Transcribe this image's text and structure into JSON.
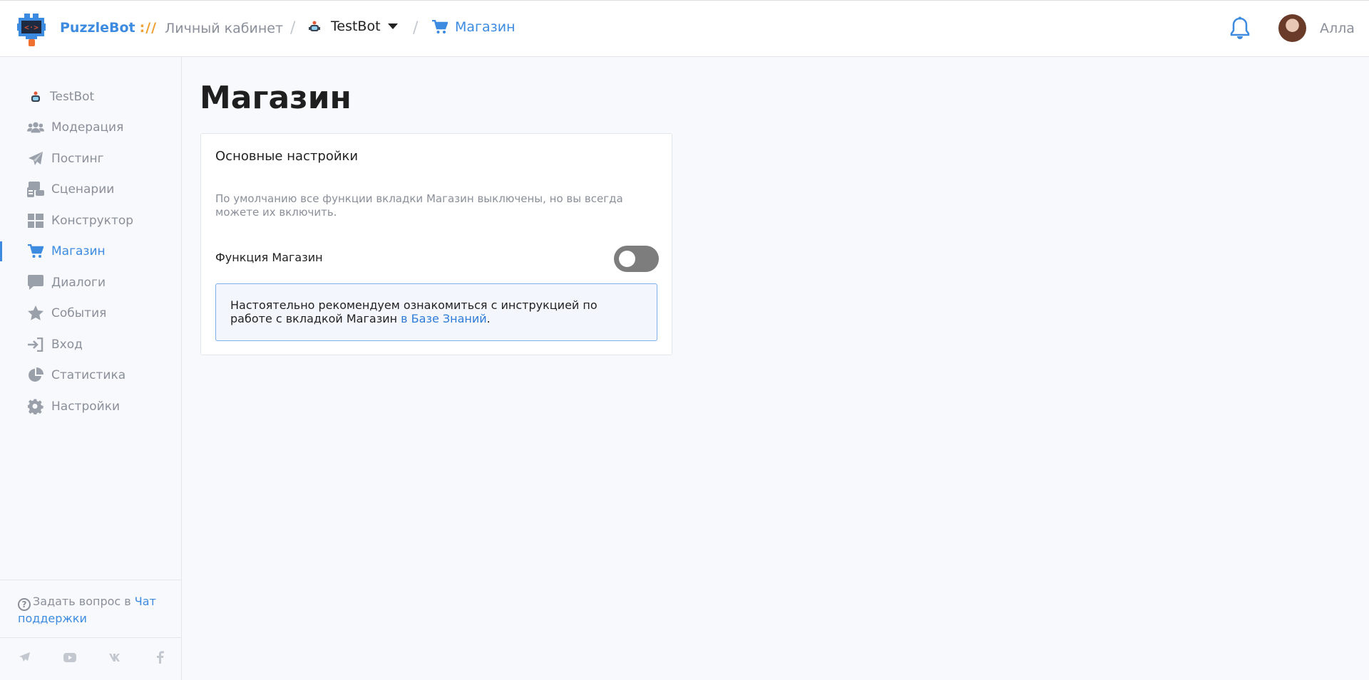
{
  "header": {
    "brand": "PuzzleBot",
    "brand_sep": "://",
    "crumb_home": "Личный кабинет",
    "crumb_bot": "TestBot",
    "crumb_current": "Магазин",
    "user_name": "Алла"
  },
  "sidebar": {
    "items": [
      {
        "label": "TestBot",
        "icon": "bot-icon"
      },
      {
        "label": "Модерация",
        "icon": "users-icon"
      },
      {
        "label": "Постинг",
        "icon": "paper-plane-icon"
      },
      {
        "label": "Сценарии",
        "icon": "scenario-icon"
      },
      {
        "label": "Конструктор",
        "icon": "grid-icon"
      },
      {
        "label": "Магазин",
        "icon": "cart-icon",
        "active": true
      },
      {
        "label": "Диалоги",
        "icon": "chat-icon"
      },
      {
        "label": "События",
        "icon": "star-icon"
      },
      {
        "label": "Вход",
        "icon": "sign-in-icon"
      },
      {
        "label": "Статистика",
        "icon": "pie-chart-icon"
      },
      {
        "label": "Настройки",
        "icon": "gear-icon"
      }
    ],
    "help_text": "Задать вопрос в",
    "help_link": "Чат поддержки",
    "socials": [
      "telegram-icon",
      "youtube-icon",
      "vk-icon",
      "facebook-icon"
    ]
  },
  "main": {
    "title": "Магазин",
    "card": {
      "title": "Основные настройки",
      "description": "По умолчанию все функции вкладки Магазин выключены, но вы всегда можете их включить.",
      "function_label": "Функция Магазин",
      "toggle_on": false,
      "notice_text": "Настоятельно рекомендуем ознакомиться с инструкцией по работе с вкладкой Магазин",
      "notice_link": "в Базе Знаний",
      "notice_end": "."
    }
  },
  "colors": {
    "accent": "#3d8be0",
    "muted": "#8a8f99",
    "brand_sep": "#f0a030",
    "toggle_off": "#7d7d7d"
  }
}
